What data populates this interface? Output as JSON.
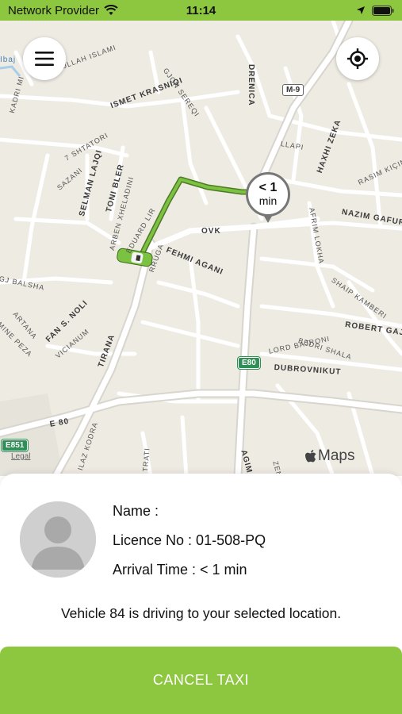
{
  "status_bar": {
    "carrier": "Network Provider",
    "time": "11:14"
  },
  "map": {
    "streets": {
      "kadri_mi": "KADRI MI",
      "jetullah": "JETULLAH ISLAMI",
      "ismet": "ISMET KRASNIQI",
      "gjon": "GJON SEREQI",
      "drenica": "DRENICA",
      "zeka": "HAXHI ZEKA",
      "llapi": "LLAPI",
      "shtatori": "7 SHTATORI",
      "sazani": "SAZANI",
      "selman": "SELMAN LAJQI",
      "toni": "TONI BLER",
      "arben": "ARBEN XHELADINI",
      "eduard": "EDUARD LIR",
      "rasim": "RASIM KIÇINA",
      "nazim": "NAZIM GAFURI",
      "afrim": "AFRIM LOKHA",
      "ovk": "OVK",
      "fehmi": "FEHMI AGANI",
      "rruga": "RRUGA",
      "balsha": "GJ BALSHA",
      "noli": "FAN S. NOLI",
      "vicianum": "VICIANUM",
      "artana": "ARTANA",
      "tirana": "TIRANA",
      "mine": "MINE PEZA",
      "shaip": "SHAIP KAMBERI",
      "robert": "ROBERT GAJ",
      "bajrami": "LORD BAJRONI",
      "bedri": "BEDRI SHALA",
      "dubrovnik": "DUBROVNIKUT",
      "e80": "E 80",
      "ilaz": "ILAZ KODRA",
      "kodra2": "TRATI",
      "agim": "AGIM",
      "zana": "ZENA",
      "bajaj": "Ibaj"
    },
    "shields": {
      "m9": "M-9",
      "e80": "E80",
      "e851": "E851"
    },
    "eta_value": "< 1",
    "eta_unit": "min",
    "apple_maps": "Maps",
    "legal": "Legal",
    "route_color": "#7cc242",
    "menu_icon": "hamburger-menu-icon",
    "locate_icon": "crosshair-locate-icon"
  },
  "driver": {
    "name_label": "Name :",
    "licence_label": "Licence No : 01-508-PQ",
    "arrival_label": "Arrival Time : < 1 min"
  },
  "status_message": "Vehicle 84 is driving to your selected location.",
  "cancel_button": "CANCEL TAXI",
  "colors": {
    "accent": "#8dc63f"
  }
}
